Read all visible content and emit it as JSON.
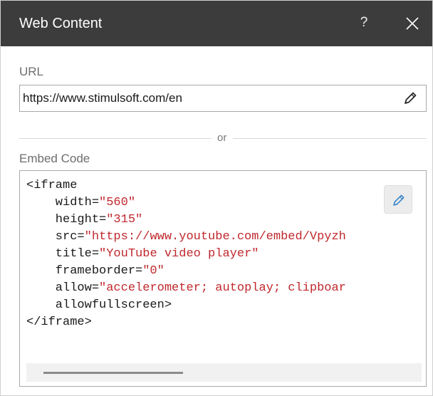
{
  "dialog": {
    "title": "Web Content",
    "help_label": "?",
    "close_icon": "close-icon"
  },
  "url": {
    "label": "URL",
    "value": "https://www.stimulsoft.com/en",
    "edit_icon": "pencil-icon"
  },
  "separator": {
    "text": "or"
  },
  "embed": {
    "label": "Embed Code",
    "edit_icon": "pencil-icon",
    "lines": [
      {
        "pre": "<iframe",
        "str": ""
      },
      {
        "pre": "    width=",
        "str": "\"560\""
      },
      {
        "pre": "    height=",
        "str": "\"315\""
      },
      {
        "pre": "    src=",
        "str": "\"https://www.youtube.com/embed/Vpyzh"
      },
      {
        "pre": "    title=",
        "str": "\"YouTube video player\""
      },
      {
        "pre": "    frameborder=",
        "str": "\"0\""
      },
      {
        "pre": "    allow=",
        "str": "\"accelerometer; autoplay; clipboar"
      },
      {
        "pre": "    allowfullscreen>",
        "str": ""
      },
      {
        "pre": "</iframe>",
        "str": ""
      }
    ]
  },
  "colors": {
    "titlebar": "#3c3c3c",
    "string": "#c0282d",
    "label": "#6e6e6e",
    "border": "#a9a9a9"
  }
}
